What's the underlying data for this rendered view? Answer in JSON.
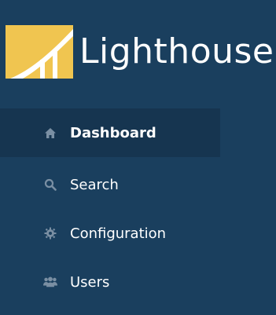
{
  "brand": {
    "name": "Lighthouse",
    "logo_icon": "lighthouse-logo-icon",
    "logo_color": "#f0c550"
  },
  "colors": {
    "sidebar_bg": "#1a3f5e",
    "active_bg": "#163550",
    "text": "#ffffff",
    "icon": "#7a8fa3"
  },
  "nav": {
    "items": [
      {
        "label": "Dashboard",
        "icon": "home-icon",
        "active": true
      },
      {
        "label": "Search",
        "icon": "search-icon",
        "active": false
      },
      {
        "label": "Configuration",
        "icon": "gear-icon",
        "active": false
      },
      {
        "label": "Users",
        "icon": "users-icon",
        "active": false
      }
    ]
  }
}
